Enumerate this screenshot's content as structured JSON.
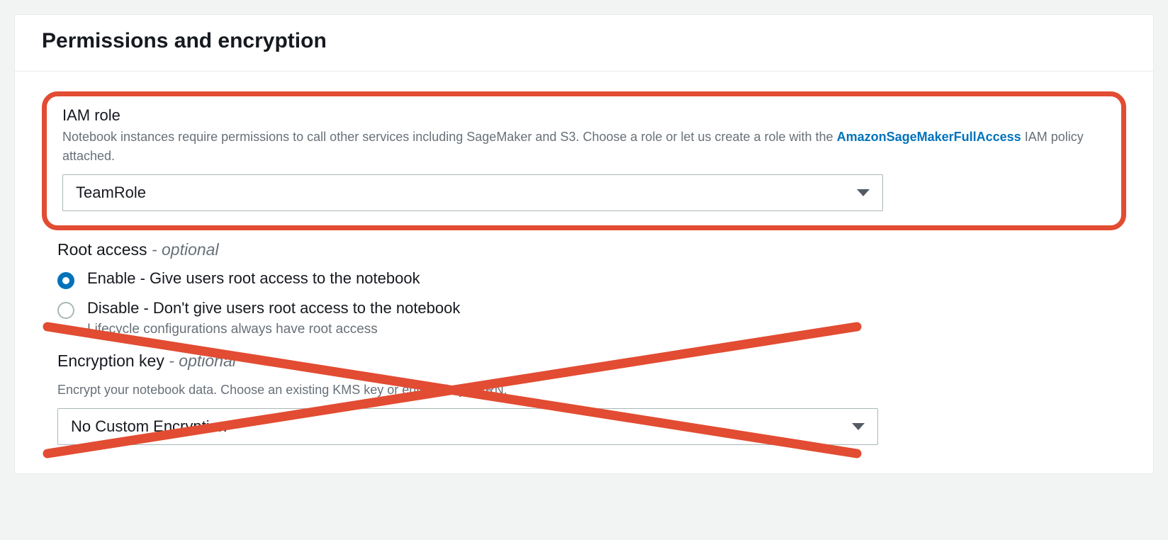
{
  "panel": {
    "title": "Permissions and encryption"
  },
  "iam": {
    "label": "IAM role",
    "description_pre": "Notebook instances require permissions to call other services including SageMaker and S3. Choose a role or let us create a role with the ",
    "policy_link_text": "AmazonSageMakerFullAccess",
    "description_post": " IAM policy attached.",
    "selected": "TeamRole"
  },
  "root_access": {
    "label": "Root access",
    "optional_text": "- optional",
    "options": [
      {
        "label": "Enable - Give users root access to the notebook",
        "checked": true,
        "sub": ""
      },
      {
        "label": "Disable - Don't give users root access to the notebook",
        "checked": false,
        "sub": "Lifecycle configurations always have root access"
      }
    ]
  },
  "encryption": {
    "label": "Encryption key",
    "optional_text": "- optional",
    "description": "Encrypt your notebook data. Choose an existing KMS key or enter a key's ARN.",
    "selected": "No Custom Encryption"
  },
  "annotations": {
    "highlight": "iam-role-section",
    "crossed_out": "encryption-section"
  }
}
